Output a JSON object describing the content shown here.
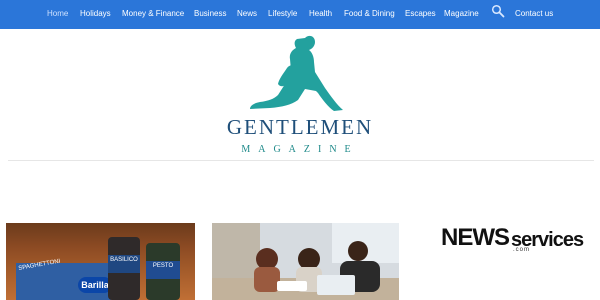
{
  "nav": {
    "items": [
      {
        "label": "Home"
      },
      {
        "label": "Holidays"
      },
      {
        "label": "Money & Finance"
      },
      {
        "label": "Business"
      },
      {
        "label": "News"
      },
      {
        "label": "Lifestyle"
      },
      {
        "label": "Health"
      },
      {
        "label": "Food & Dining"
      },
      {
        "label": "Escapes"
      },
      {
        "label": "Magazine"
      },
      {
        "label": "Contact us"
      }
    ],
    "search_icon": "search-icon"
  },
  "logo": {
    "title": "GENTLEMEN",
    "subtitle": "MAGAZINE",
    "color_title": "#1f4f7a",
    "color_figure": "#23a19e"
  },
  "articles": {
    "food": {
      "pasta_label": "SPAGHETTONI",
      "jar1_label": "BASILICO",
      "jar2_label": "PESTO",
      "brand_label": "Barilla"
    },
    "office": {}
  },
  "partner": {
    "name_big": "NEWS",
    "name_small": "services",
    "suffix": ".com"
  }
}
